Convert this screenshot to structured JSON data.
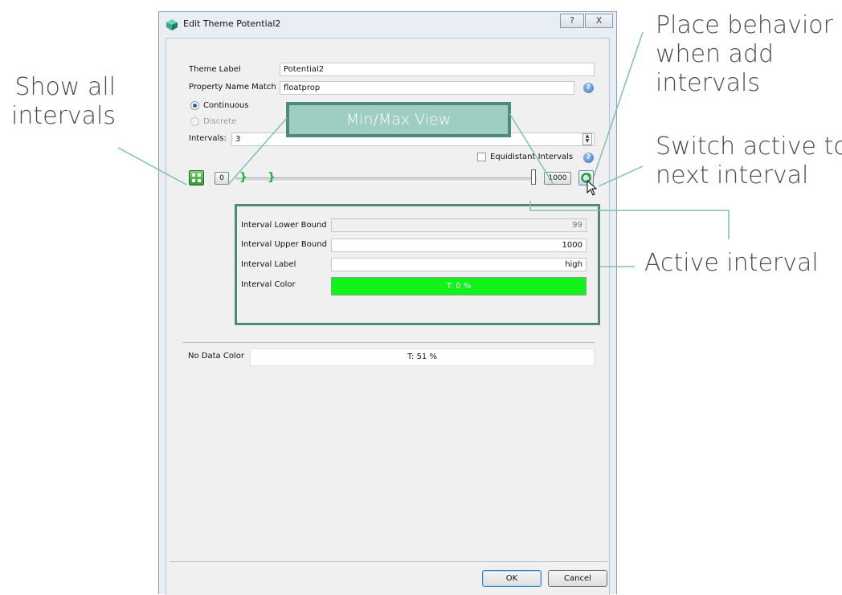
{
  "dialog": {
    "title": "Edit Theme Potential2",
    "help_button": "?",
    "close_button": "X"
  },
  "form": {
    "theme_label_label": "Theme Label",
    "theme_label_value": "Potential2",
    "property_name_label": "Property Name Match",
    "property_name_value": "floatprop",
    "continuous_label": "Continuous",
    "continuous_selected": true,
    "discrete_label": "Discrete",
    "discrete_enabled": false,
    "intervals_label": "Intervals:",
    "intervals_value": "3",
    "equidistant_label": "Equidistant Intervals",
    "equidistant_checked": false
  },
  "slider": {
    "min_value": "0",
    "max_value": "1000"
  },
  "interval": {
    "lower_bound_label": "Interval Lower Bound",
    "lower_bound_value": "99",
    "upper_bound_label": "Interval Upper Bound",
    "upper_bound_value": "1000",
    "label_label": "Interval Label",
    "label_value": "high",
    "color_label": "Interval Color",
    "color_text": "T: 0 %",
    "color_hex": "#11f21a"
  },
  "no_data": {
    "label": "No Data Color",
    "color_text": "T: 51 %",
    "color_hex": "#ffffff"
  },
  "buttons": {
    "ok": "OK",
    "cancel": "Cancel"
  },
  "annotations": {
    "show_all": "Show all\nintervals",
    "place_behavior": "Place behavior\nwhen add\nintervals",
    "switch_active": "Switch active to\nnext interval",
    "active_interval": "Active interval",
    "min_max_view": "Min/Max View"
  },
  "colors": {
    "annotation_line": "#7fbfb2",
    "annotation_box": "#4e8a7c",
    "annotation_fill": "#9ecdc2"
  }
}
